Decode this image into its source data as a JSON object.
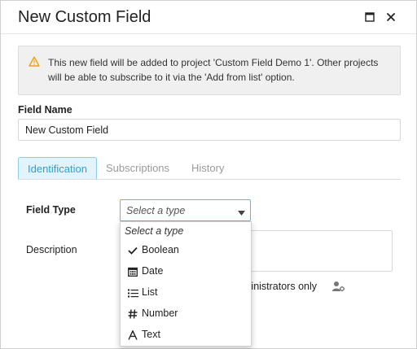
{
  "dialog": {
    "title": "New Custom Field",
    "icons": {
      "maximize": "maximize-icon",
      "close": "close-icon"
    }
  },
  "notice": {
    "icon": "warning-icon",
    "message": "This new field will be added to project 'Custom Field Demo 1'. Other projects will be able to subscribe to it via the 'Add from list' option."
  },
  "field_name": {
    "label": "Field Name",
    "value": "New Custom Field"
  },
  "tabs": [
    {
      "label": "Identification",
      "active": true
    },
    {
      "label": "Subscriptions",
      "active": false
    },
    {
      "label": "History",
      "active": false
    }
  ],
  "form": {
    "field_type_label": "Field Type",
    "field_type_select": {
      "value": "Select a type"
    },
    "description_label": "Description",
    "admin_note": "ministrators only"
  },
  "dropdown": {
    "placeholder": "Select a type",
    "options": [
      {
        "label": "Boolean",
        "icon": "checkmark-icon",
        "selected": true
      },
      {
        "label": "Date",
        "icon": "calendar-icon",
        "selected": false
      },
      {
        "label": "List",
        "icon": "list-icon",
        "selected": false
      },
      {
        "label": "Number",
        "icon": "hash-icon",
        "selected": false
      },
      {
        "label": "Text",
        "icon": "text-a-icon",
        "selected": false
      }
    ]
  },
  "colors": {
    "accent": "#2d9fd6",
    "tab_active_bg": "#e3f3fb",
    "warning": "#e8a317",
    "notice_bg": "#f1f0f0"
  }
}
